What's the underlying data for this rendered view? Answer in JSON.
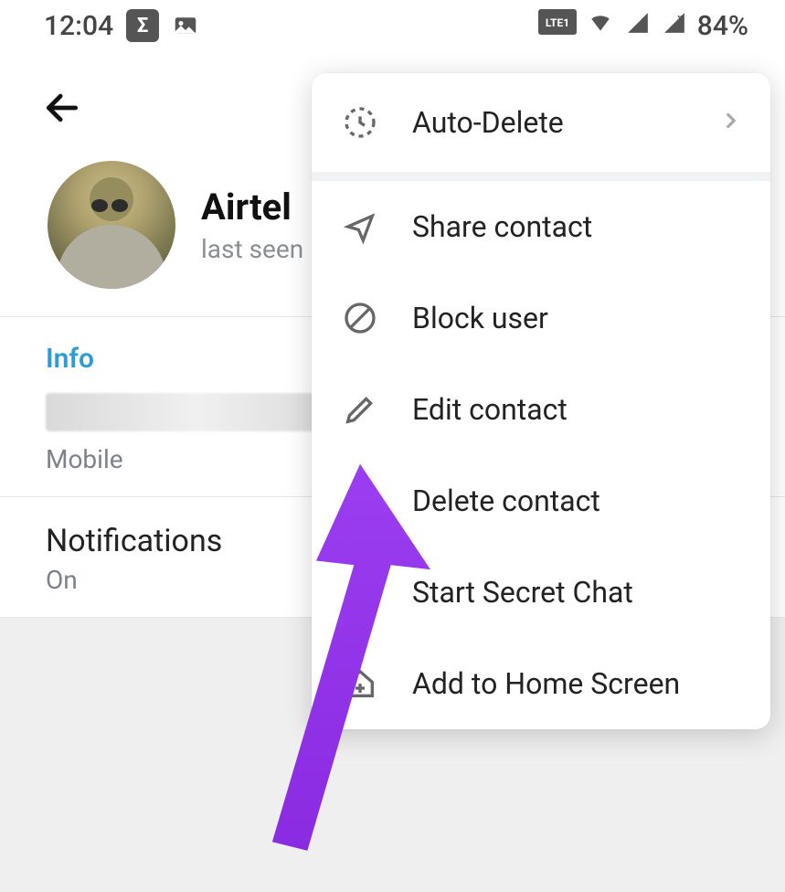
{
  "statusbar": {
    "time": "12:04",
    "sigma": "Σ",
    "volte_label": "LTE1",
    "battery_pct": "84%"
  },
  "contact": {
    "name": "Airtel",
    "last_seen": "last seen"
  },
  "info": {
    "section_title": "Info",
    "phone_label": "Mobile",
    "notifications_title": "Notifications",
    "notifications_value": "On"
  },
  "menu": {
    "auto_delete": "Auto-Delete",
    "share_contact": "Share contact",
    "block_user": "Block user",
    "edit_contact": "Edit contact",
    "delete_contact": "Delete contact",
    "start_secret_chat": "Start Secret Chat",
    "add_home_screen": "Add to Home Screen"
  }
}
